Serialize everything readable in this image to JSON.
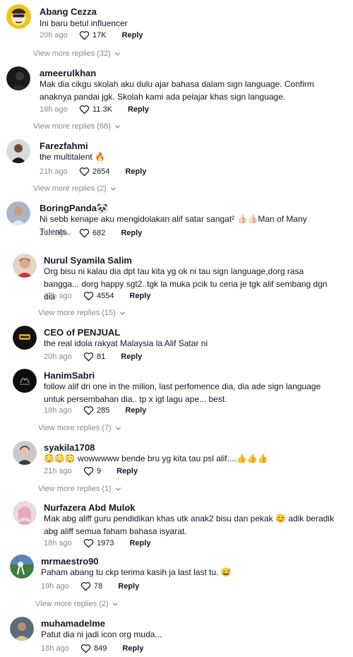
{
  "comments": [
    {
      "username": "Abang Cezza",
      "text": "Ini baru betul influencer",
      "time": "20h ago",
      "likes": "17K",
      "reply": "Reply",
      "view_more": "View more replies (32)"
    },
    {
      "username": "ameerulkhan",
      "text": "Mak dia cikgu skolah aku dulu ajar bahasa dalam sign language. Confirm anaknya pandai jgk. Skolah kami ada pelajar khas sign language.",
      "time": "18h ago",
      "likes": "11.3K",
      "reply": "Reply",
      "view_more": "View more replies (68)"
    },
    {
      "username": "Farezfahmi",
      "text": "the multitalent 🔥",
      "time": "21h ago",
      "likes": "2654",
      "reply": "Reply",
      "view_more": "View more replies (2)"
    },
    {
      "username": "BoringPanda🐼",
      "text": "Ni sebb kenape aku mengidolakan alif satar sangat² 👍🏻👍🏻Man of Many Talents..",
      "time": "20h ago",
      "likes": "682",
      "reply": "Reply"
    },
    {
      "username": "Nurul Syamila Salim",
      "text": "Org bisu ni kalau dia dpt tau kita yg ok ni tau sign language,dorg rasa bangga... dorg happy sgt2..tgk la muka pcik tu ceria je tgk alif sembang dgn dia",
      "time": "17h ago",
      "likes": "4554",
      "reply": "Reply",
      "view_more": "View more replies (15)"
    },
    {
      "username": "CEO of PENJUAL",
      "text": "the real idola rakyat Malaysia la Alif Satar ni",
      "time": "20h ago",
      "likes": "81",
      "reply": "Reply"
    },
    {
      "username": "HanimSabri",
      "text": "follow alif dri one in the milion, last perfomence dia, dia ade sign language untuk persembahan dia.. tp x igt lagu ape... best.",
      "time": "18h ago",
      "likes": "285",
      "reply": "Reply",
      "view_more": "View more replies (7)"
    },
    {
      "username": "syakila1708",
      "text": "😳😳😳 wowwwww bende bru yg kita tau psl alif....👍👍👍",
      "time": "21h ago",
      "likes": "9",
      "reply": "Reply",
      "view_more": "View more replies (1)"
    },
    {
      "username": "Nurfazera Abd Mulok",
      "text": "Mak abg aliff guru pendidikan khas utk anak2 bisu dan pekak 😊 adik beradik abg aliff semua faham bahasa isyarat.",
      "time": "18h ago",
      "likes": "1973",
      "reply": "Reply"
    },
    {
      "username": "mrmaestro90",
      "text": "Paham abang tu ckp terima kasih ja last last tu. 😅",
      "time": "19h ago",
      "likes": "78",
      "reply": "Reply",
      "view_more": "View more replies (2)"
    },
    {
      "username": "muhamadelme",
      "text": "Patut dia ni jadi icon org muda...",
      "time": "18h ago",
      "likes": "849",
      "reply": "Reply"
    }
  ],
  "colors": {
    "text": "#161823",
    "muted": "#8a8b91",
    "background": "#ffffff"
  },
  "icons": {
    "like": "heart-outline-icon",
    "expand": "chevron-down-icon"
  }
}
